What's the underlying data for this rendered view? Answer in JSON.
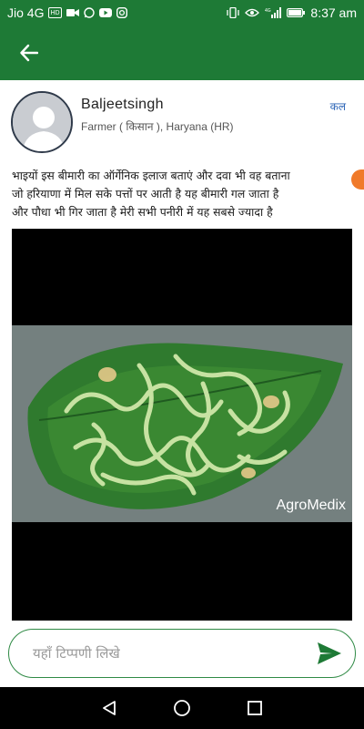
{
  "status_bar": {
    "carrier": "Jio 4G",
    "time": "8:37 am",
    "left_icons": [
      "hd-voice-icon",
      "video-icon",
      "whatsapp-icon",
      "youtube-icon",
      "instagram-icon"
    ],
    "right_icons": [
      "vibrate-icon",
      "eye-comfort-icon",
      "signal-icon",
      "battery-icon"
    ]
  },
  "app_bar": {
    "back_icon": "arrow-left-icon"
  },
  "post": {
    "user_name": "Baljeetsingh",
    "user_meta": "Farmer ( किसान ), Haryana (HR)",
    "time": "कल",
    "text_lines": [
      "भाइयों इस बीमारी का ऑर्गेनिक इलाज बताएं और दवा भी वह बताना",
      "जो हरियाणा में मिल सके पत्तों पर आती है यह बीमारी  गल जाता है",
      "और पौधा भी गिर जाता है मेरी सभी पनीरी में यह सबसे ज्यादा है"
    ],
    "image_watermark": "AgroMedix"
  },
  "comment": {
    "placeholder": "यहाँ टिप्पणी लिखे",
    "send_icon": "send-icon"
  },
  "nav": {
    "icons": [
      "back-triangle-icon",
      "home-circle-icon",
      "recents-square-icon"
    ]
  },
  "colors": {
    "primary": "#1e7a36",
    "accent_link": "#2a63b6",
    "send": "#1e7a36"
  }
}
